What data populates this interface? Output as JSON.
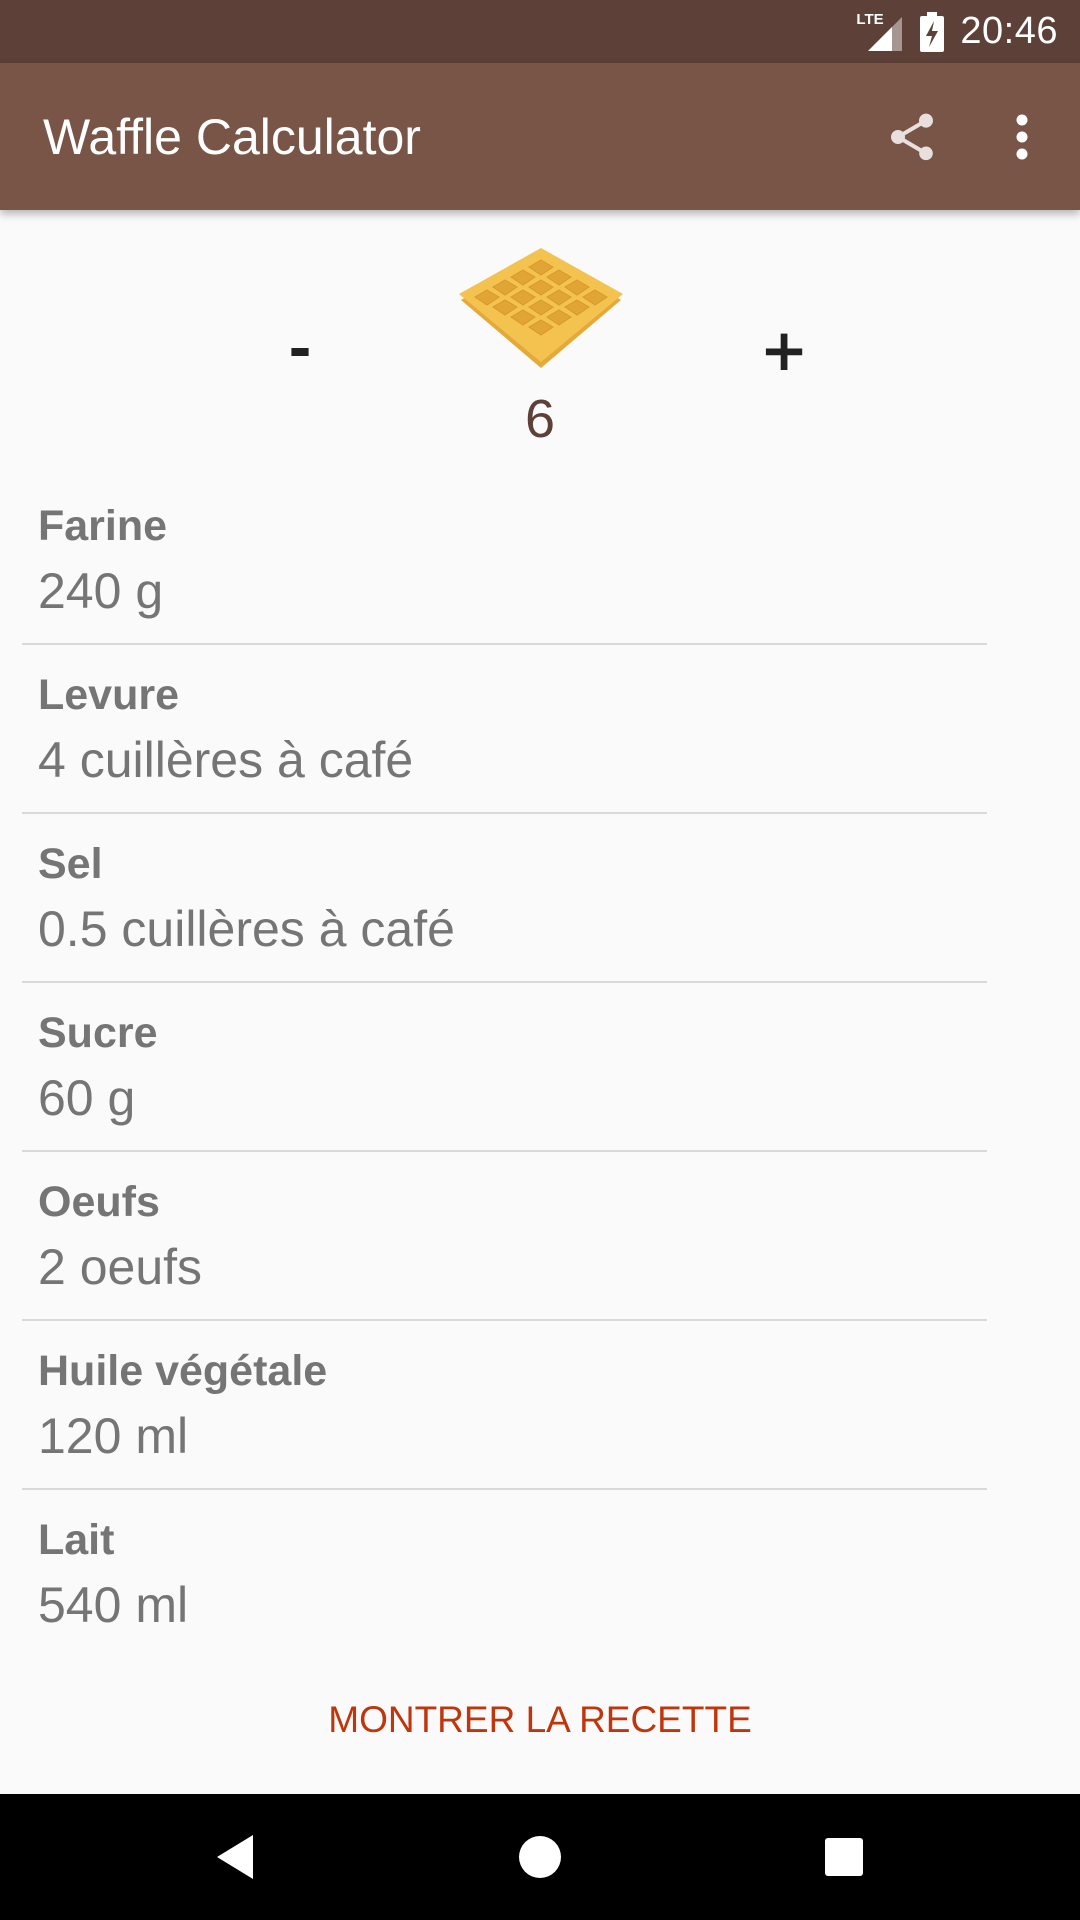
{
  "status_bar": {
    "network": "LTE",
    "time": "20:46"
  },
  "app_bar": {
    "title": "Waffle Calculator",
    "share_icon": "share-icon",
    "menu_icon": "more-vert-icon"
  },
  "counter": {
    "minus_label": "-",
    "plus_label": "+",
    "count": "6",
    "waffle_icon": "waffle-icon"
  },
  "ingredients": [
    {
      "name": "Farine",
      "value": "240 g"
    },
    {
      "name": "Levure",
      "value": "4 cuillères à café"
    },
    {
      "name": "Sel",
      "value": "0.5 cuillères à café"
    },
    {
      "name": "Sucre",
      "value": "60 g"
    },
    {
      "name": "Oeufs",
      "value": "2 oeufs"
    },
    {
      "name": "Huile végétale",
      "value": "120 ml"
    },
    {
      "name": "Lait",
      "value": "540 ml"
    }
  ],
  "recipe_button": "MONTRER LA RECETTE",
  "colors": {
    "status_bar": "#5d4037",
    "app_bar": "#795548",
    "accent": "#bf360c",
    "waffle": "#f2c14e"
  },
  "nav_bar": {
    "back_icon": "back-icon",
    "home_icon": "home-icon",
    "recents_icon": "recents-icon"
  }
}
